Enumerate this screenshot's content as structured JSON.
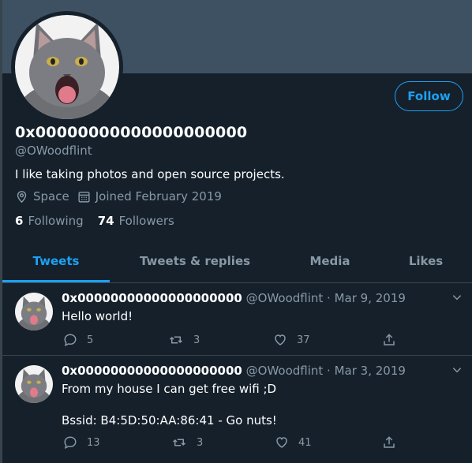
{
  "profile": {
    "display_name": "0x00000000000000000000",
    "handle": "@OWoodflint",
    "bio": "I like taking photos and open source projects.",
    "location": "Space",
    "joined": "Joined February 2019",
    "following_count": "6",
    "following_label": "Following",
    "followers_count": "74",
    "followers_label": "Followers",
    "follow_label": "Follow",
    "avatar_icon": "gray-kitten-avatar"
  },
  "tabs": [
    {
      "label": "Tweets",
      "active": true
    },
    {
      "label": "Tweets & replies",
      "active": false
    },
    {
      "label": "Media",
      "active": false
    },
    {
      "label": "Likes",
      "active": false
    }
  ],
  "tweets": [
    {
      "name": "0x00000000000000000000",
      "meta": "@OWoodflint · Mar 9, 2019",
      "text": "Hello world!",
      "replies": "5",
      "retweets": "3",
      "likes": "37"
    },
    {
      "name": "0x00000000000000000000",
      "meta": "@OWoodflint · Mar 3, 2019",
      "text": "From my house I can get free wifi ;D\n\nBssid: B4:5D:50:AA:86:41 - Go nuts!",
      "replies": "13",
      "retweets": "3",
      "likes": "41"
    }
  ],
  "colors": {
    "background": "#15202b",
    "banner": "#3e5163",
    "accent": "#1da1f2",
    "secondary_text": "#8899a6",
    "border": "#38444d"
  },
  "icons": {
    "location": "location-pin-icon",
    "calendar": "calendar-icon",
    "reply": "reply-icon",
    "retweet": "retweet-icon",
    "like": "heart-icon",
    "share": "share-icon",
    "caret": "chevron-down-icon"
  }
}
